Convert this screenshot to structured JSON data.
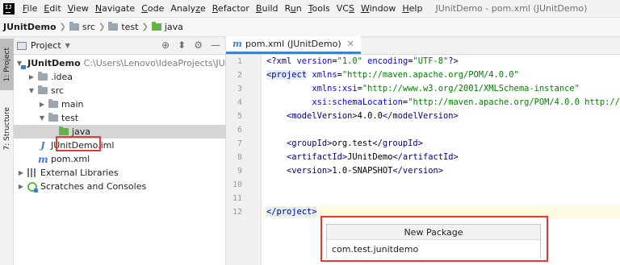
{
  "menubar": {
    "items": [
      {
        "u": "F",
        "rest": "ile"
      },
      {
        "u": "E",
        "rest": "dit"
      },
      {
        "u": "V",
        "rest": "iew"
      },
      {
        "u": "N",
        "rest": "avigate"
      },
      {
        "u": "C",
        "rest": "ode"
      },
      {
        "pre": "Analy",
        "u": "z",
        "rest": "e"
      },
      {
        "u": "R",
        "rest": "efactor"
      },
      {
        "u": "B",
        "rest": "uild"
      },
      {
        "pre": "R",
        "u": "u",
        "rest": "n"
      },
      {
        "u": "T",
        "rest": "ools"
      },
      {
        "pre": "VC",
        "u": "S",
        "rest": ""
      },
      {
        "u": "W",
        "rest": "indow"
      },
      {
        "u": "H",
        "rest": "elp"
      }
    ],
    "window_title": "JUnitDemo - pom.xml (JUnitDemo)"
  },
  "breadcrumb": {
    "items": [
      "JUnitDemo",
      "src",
      "test",
      "java"
    ]
  },
  "toolstrip": {
    "project_tab": "1: Project",
    "structure_tab": "7: Structure"
  },
  "project_panel": {
    "title": "Project",
    "tree": [
      {
        "label": "JUnitDemo",
        "hint": "C:\\Users\\Lenovo\\IdeaProjects\\JUnitDemo",
        "icon": "module-folder-icon"
      },
      {
        "label": ".idea",
        "icon": "folder-icon"
      },
      {
        "label": "src",
        "icon": "folder-icon"
      },
      {
        "label": "main",
        "icon": "folder-icon"
      },
      {
        "label": "test",
        "icon": "folder-icon"
      },
      {
        "label": "java",
        "icon": "test-source-folder-icon"
      },
      {
        "label": "JUnitDemo.iml",
        "icon": "iml-file-icon"
      },
      {
        "label": "pom.xml",
        "icon": "maven-file-icon"
      },
      {
        "label": "External Libraries",
        "icon": "library-icon"
      },
      {
        "label": "Scratches and Consoles",
        "icon": "scratch-icon"
      }
    ]
  },
  "editor": {
    "tab_label": "pom.xml (JUnitDemo)",
    "line_numbers": [
      "1",
      "2",
      "3",
      "4",
      "5",
      "6",
      "7",
      "8",
      "9",
      "10",
      "11",
      "12"
    ],
    "lines": {
      "l1": {
        "a": "<?xml ",
        "b": "version",
        "c": "=",
        "d": "\"1.0\"",
        "e": " ",
        "f": "encoding",
        "g": "=",
        "h": "\"UTF-8\"",
        "i": "?>"
      },
      "l2": {
        "a": "<project",
        "b": " ",
        "c": "xmlns",
        "d": "=",
        "e": "\"http://maven.apache.org/POM/4.0.0\""
      },
      "l3": {
        "a": "         ",
        "b": "xmlns:xsi",
        "c": "=",
        "d": "\"http://www.w3.org/2001/XMLSchema-instance\""
      },
      "l4": {
        "a": "         ",
        "b": "xsi:schemaLocation",
        "c": "=",
        "d": "\"http://maven.apache.org/POM/4.0.0 http://maven.apache.org/xsd/maven-4.0.0.xsd\">"
      },
      "l5": {
        "a": "    ",
        "b": "<modelVersion>",
        "c": "4.0.0",
        "d": "</modelVersion>"
      },
      "l7": {
        "a": "    ",
        "b": "<groupId>",
        "c": "org.test",
        "d": "</groupId>"
      },
      "l8": {
        "a": "    ",
        "b": "<artifactId>",
        "c": "JUnitDemo",
        "d": "</artifactId>"
      },
      "l9": {
        "a": "    ",
        "b": "<version>",
        "c": "1.0-SNAPSHOT",
        "d": "</version>"
      },
      "l12": {
        "a": "</project>"
      }
    }
  },
  "new_package_popup": {
    "title": "New Package",
    "value": "com.test.junitdemo"
  },
  "colors": {
    "highlight_red": "#e53935",
    "accent_blue": "#4083c9",
    "test_folder_green": "#62b543"
  }
}
